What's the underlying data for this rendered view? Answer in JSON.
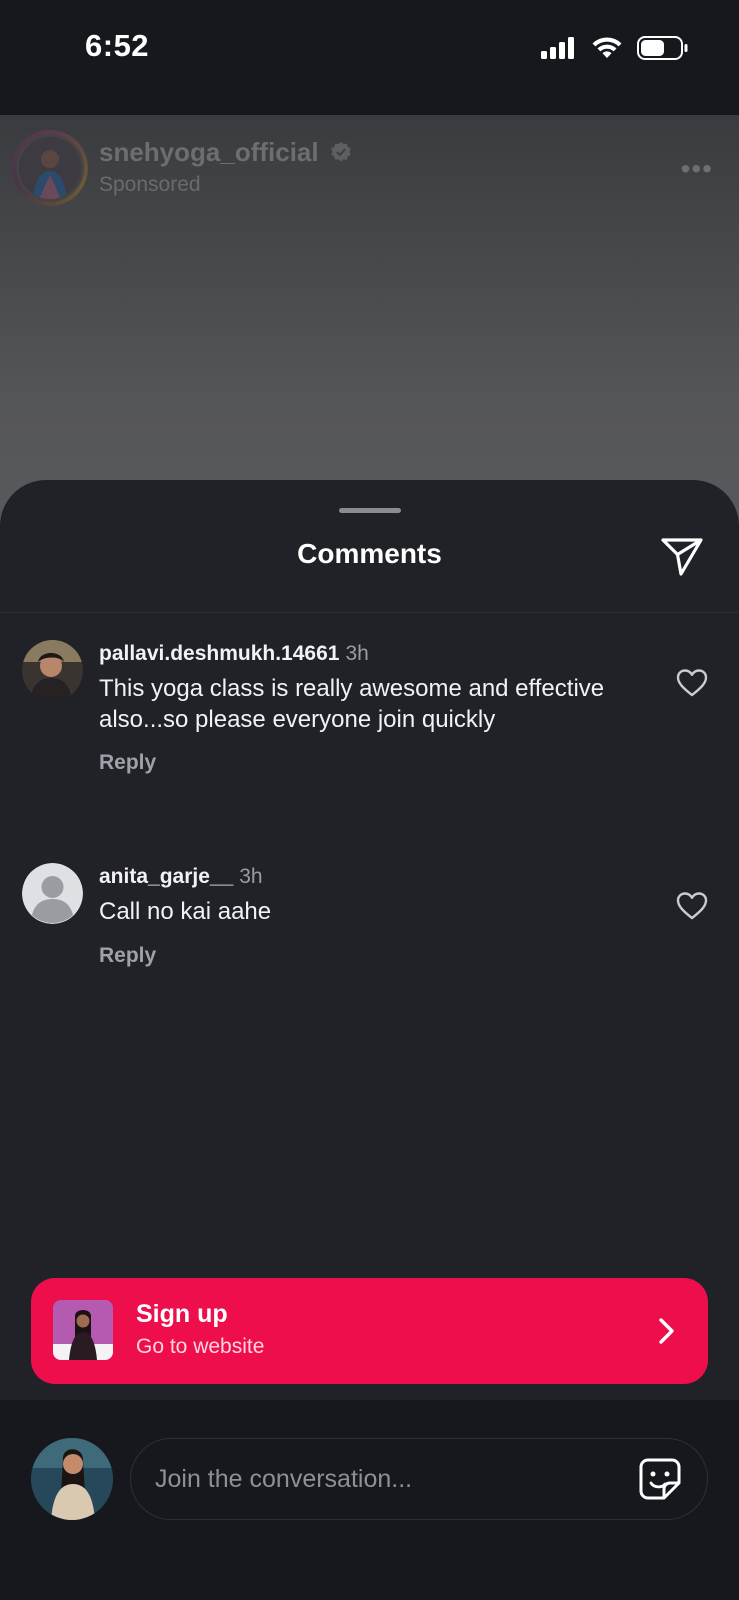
{
  "status_bar": {
    "time": "6:52"
  },
  "post": {
    "username": "snehyoga_official",
    "sponsored_label": "Sponsored",
    "more_label": "•••"
  },
  "sheet": {
    "title": "Comments"
  },
  "comments": [
    {
      "username": "pallavi.deshmukh.14661",
      "time": "3h",
      "text": "This yoga class is really awesome and effective also...so please  everyone join quickly",
      "reply_label": "Reply"
    },
    {
      "username": "anita_garje__",
      "time": "3h",
      "text": "Call no kai aahe",
      "reply_label": "Reply"
    }
  ],
  "cta": {
    "title": "Sign up",
    "subtitle": "Go to website",
    "color": "#ee0e4c"
  },
  "composer": {
    "placeholder": "Join the conversation..."
  },
  "icons": [
    "signal-icon",
    "wifi-icon",
    "battery-icon",
    "verified-icon",
    "more-icon",
    "share-icon",
    "heart-icon",
    "chevron-right-icon",
    "sticker-icon"
  ]
}
